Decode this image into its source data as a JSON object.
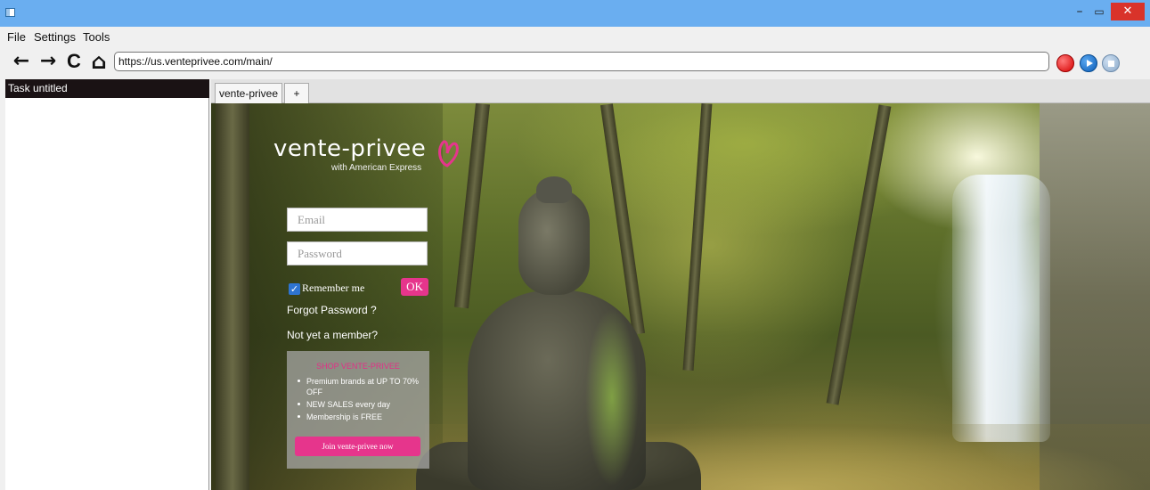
{
  "window": {
    "minimize_glyph": "–",
    "maximize_glyph": "▭",
    "close_glyph": "✕"
  },
  "menu": {
    "items": [
      "File",
      "Settings",
      "Tools"
    ]
  },
  "toolbar": {
    "back_glyph": "←",
    "forward_glyph": "→",
    "reload_glyph": "C",
    "home_glyph": "⌂",
    "url": "https://us.venteprivee.com/main/",
    "icons": [
      "back-arrow-icon",
      "forward-arrow-icon",
      "reload-icon",
      "home-icon",
      "record-icon",
      "play-icon",
      "stop-icon"
    ],
    "record_color": "#d60000",
    "play_color": "#0b5cb8"
  },
  "task": {
    "title": "Task untitled"
  },
  "tabs": {
    "active_label": "vente-privee",
    "add_label": "+"
  },
  "page": {
    "logo": "vente-privee",
    "logo_sub": "with American Express",
    "email_placeholder": "Email",
    "password_placeholder": "Password",
    "remember_label": "Remember me",
    "ok_label": "OK",
    "forgot_link": "Forgot Password ?",
    "member_link": "Not yet a member?",
    "promo": {
      "title": "SHOP VENTE-PRIVEE",
      "bullets": [
        "Premium brands at UP TO 70% OFF",
        "NEW SALES every day",
        "Membership is FREE"
      ],
      "join_label": "Join vente-privee now"
    },
    "accent_color": "#e6358c"
  }
}
